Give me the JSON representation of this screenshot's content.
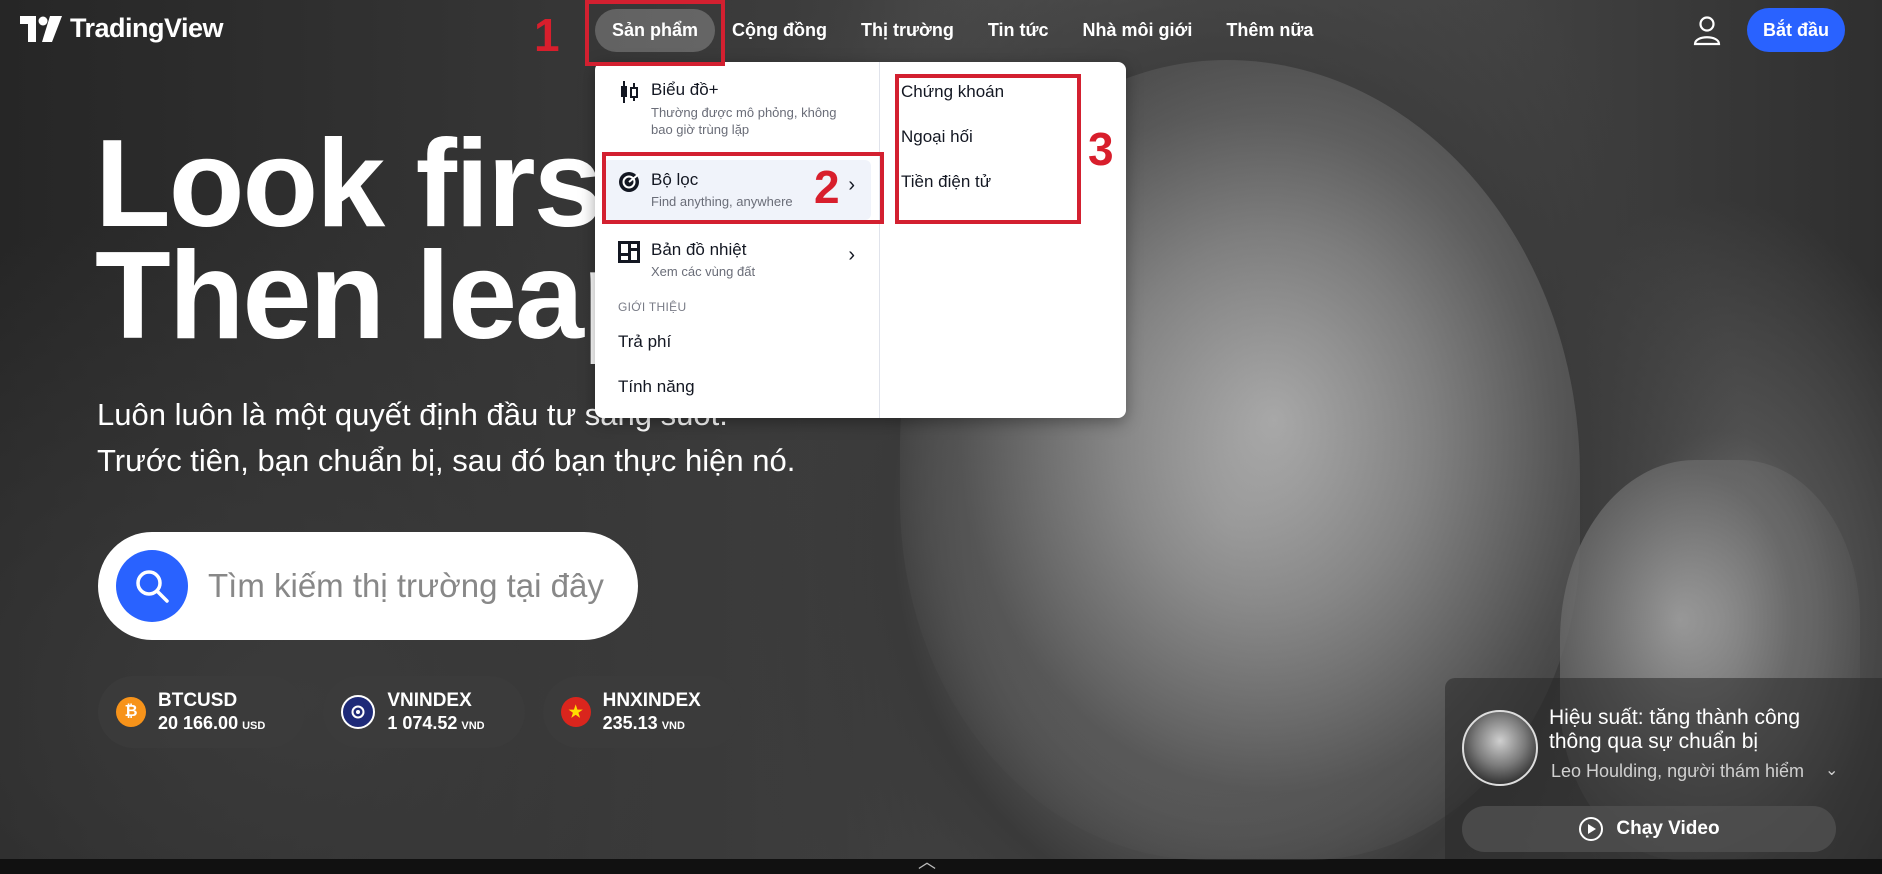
{
  "header": {
    "brand": "TradingView",
    "nav": [
      "Sản phẩm",
      "Cộng đồng",
      "Thị trường",
      "Tin tức",
      "Nhà môi giới",
      "Thêm nữa"
    ],
    "start_label": "Bắt đầu"
  },
  "hero": {
    "title_line1": "Look first",
    "title_line2": "Then leap",
    "subtitle_line1": "Luôn luôn là một quyết định đầu tư sáng suốt.",
    "subtitle_line2": "Trước tiên, bạn chuẩn bị, sau đó bạn thực hiện nó.",
    "search_placeholder": "Tìm kiếm thị trường tại đây"
  },
  "tickers": [
    {
      "symbol": "BTCUSD",
      "value": "20 166.00",
      "currency": "USD",
      "icon": "bitcoin-icon",
      "color": "#f7931a"
    },
    {
      "symbol": "VNINDEX",
      "value": "1 074.52",
      "currency": "VND",
      "icon": "vnindex-icon",
      "color": "#1e2a78"
    },
    {
      "symbol": "HNXINDEX",
      "value": "235.13",
      "currency": "VND",
      "icon": "vietnam-flag-icon",
      "color": "#da251d"
    }
  ],
  "dropdown": {
    "items": [
      {
        "title": "Biểu đồ+",
        "subtitle_line1": "Thường được mô phỏng, không",
        "subtitle_line2": "bao giờ trùng lặp",
        "icon": "candlestick-icon"
      },
      {
        "title": "Bộ lọc",
        "subtitle": "Find anything, anywhere",
        "icon": "screener-icon"
      },
      {
        "title": "Bản đồ nhiệt",
        "subtitle": "Xem các vùng đất",
        "icon": "heatmap-icon"
      }
    ],
    "section_label": "GIỚI THIỆU",
    "links": [
      "Trả phí",
      "Tính năng"
    ],
    "submenu": [
      "Chứng khoán",
      "Ngoại hối",
      "Tiền điện tử"
    ]
  },
  "annotations": [
    "1",
    "2",
    "3"
  ],
  "video": {
    "title": "Hiệu suất: tăng thành công thông qua sự chuẩn bị",
    "author": "Leo Houlding, người thám hiểm",
    "play_label": "Chạy Video"
  },
  "colors": {
    "accent": "#2962ff",
    "annotation": "#d32030"
  }
}
